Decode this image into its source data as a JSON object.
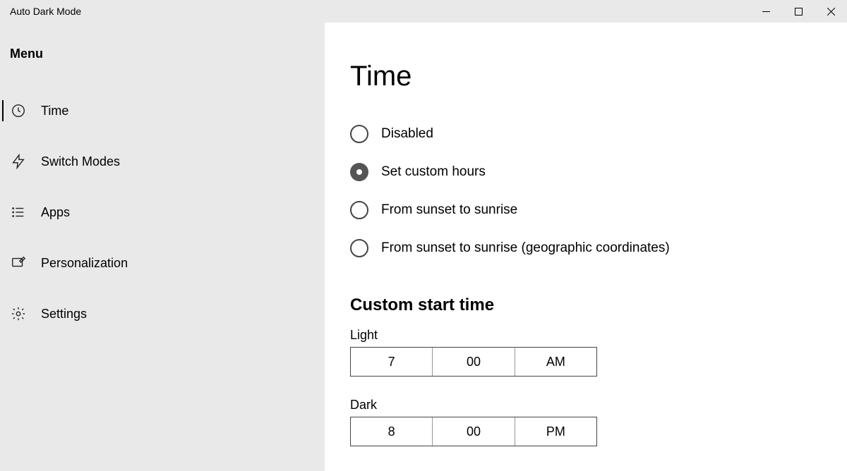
{
  "window": {
    "title": "Auto Dark Mode"
  },
  "sidebar": {
    "heading": "Menu",
    "items": [
      {
        "label": "Time"
      },
      {
        "label": "Switch Modes"
      },
      {
        "label": "Apps"
      },
      {
        "label": "Personalization"
      },
      {
        "label": "Settings"
      }
    ]
  },
  "main": {
    "title": "Time",
    "radios": [
      {
        "label": "Disabled",
        "selected": false
      },
      {
        "label": "Set custom hours",
        "selected": true
      },
      {
        "label": "From sunset to sunrise",
        "selected": false
      },
      {
        "label": "From sunset to sunrise (geographic coordinates)",
        "selected": false
      }
    ],
    "custom_heading": "Custom start time",
    "light": {
      "label": "Light",
      "hour": "7",
      "minute": "00",
      "ampm": "AM"
    },
    "dark": {
      "label": "Dark",
      "hour": "8",
      "minute": "00",
      "ampm": "PM"
    }
  }
}
